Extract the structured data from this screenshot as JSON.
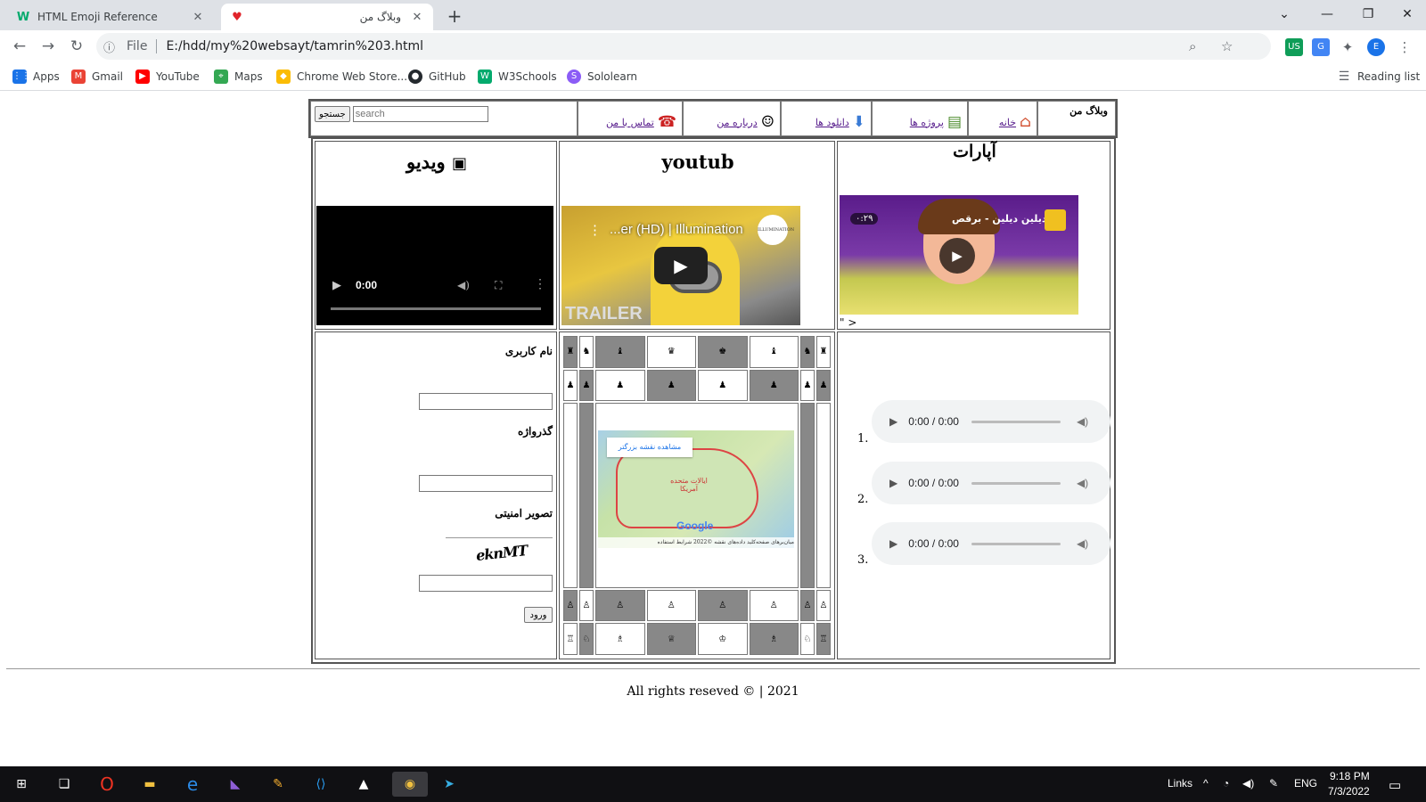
{
  "browser": {
    "tabs": [
      {
        "title": "HTML Emoji Reference",
        "favicon": "w3schools-icon"
      },
      {
        "title": "وبلاگ من",
        "favicon": "heart-icon"
      }
    ],
    "address": "E:/hdd/my%20websayt/tamrin%203.html",
    "address_prefix": "File",
    "bookmarks": [
      {
        "label": "Apps",
        "icon": "apps-grid-icon",
        "color": "#1a73e8"
      },
      {
        "label": "Gmail",
        "icon": "gmail-icon",
        "color": "#ea4335"
      },
      {
        "label": "YouTube",
        "icon": "youtube-icon",
        "color": "#ff0000"
      },
      {
        "label": "Maps",
        "icon": "maps-icon",
        "color": "#34a853"
      },
      {
        "label": "Chrome Web Store...",
        "icon": "webstore-icon",
        "color": "#fbbc04"
      },
      {
        "label": "GitHub",
        "icon": "github-icon",
        "color": "#24292e"
      },
      {
        "label": "W3Schools",
        "icon": "w3schools-icon",
        "color": "#04aa6d"
      },
      {
        "label": "Sololearn",
        "icon": "sololearn-icon",
        "color": "#8b5cf6"
      }
    ],
    "reading_list": "Reading list",
    "profile_initial": "E"
  },
  "page": {
    "nav": {
      "brand": "وبلاگ من",
      "home": "خانه",
      "projects": "پروژه ها",
      "downloads": "دانلود ها",
      "about": "درباره من",
      "contact": "تماس با من",
      "search_placeholder": "search",
      "search_button": "جستجو"
    },
    "headings": {
      "video": "ویدیو",
      "youtube": "youtub",
      "aparat": "آپارات"
    },
    "video_player": {
      "time": "0:00"
    },
    "youtube_embed": {
      "title": "...er (HD) | Illumination",
      "channel": "ILLUMINATION",
      "badge": "TRAILER"
    },
    "aparat_embed": {
      "title": "دیلین دیلین - برقص",
      "duration": "۰:۲۹",
      "stray_text": "\" >"
    },
    "form": {
      "username_label": "نام کاربری",
      "password_label": "گذرواژه",
      "captcha_label": "تصویر امنیتی",
      "captcha_text": "eknMT",
      "login_button": "ورود"
    },
    "audio": [
      {
        "num": "1.",
        "time": "0:00 / 0:00"
      },
      {
        "num": "2.",
        "time": "0:00 / 0:00"
      },
      {
        "num": "3.",
        "time": "0:00 / 0:00"
      }
    ],
    "map": {
      "view_larger": "مشاهده نقشه بزرگتر",
      "country_label": "ایالات متحده آمریکا",
      "logo": "Google",
      "attribution": "میان‌برهای صفحه‌کلید   داده‌های نقشه ©2022   شرایط استفاده"
    },
    "chess": {
      "top_back": [
        "♜",
        "♞",
        "♝",
        "♛",
        "♚",
        "♝",
        "♞",
        "♜"
      ],
      "top_pawns": [
        "♟",
        "♟",
        "♟",
        "♟",
        "♟",
        "♟",
        "♟",
        "♟"
      ],
      "bottom_pawns": [
        "♙",
        "♙",
        "♙",
        "♙",
        "♙",
        "♙",
        "♙",
        "♙"
      ],
      "bottom_back": [
        "♖",
        "♘",
        "♗",
        "♕",
        "♔",
        "♗",
        "♘",
        "♖"
      ]
    },
    "footer": "All rights reseved © | 2021"
  },
  "taskbar": {
    "links": "Links",
    "lang": "ENG",
    "time": "9:18 PM",
    "date": "7/3/2022"
  }
}
